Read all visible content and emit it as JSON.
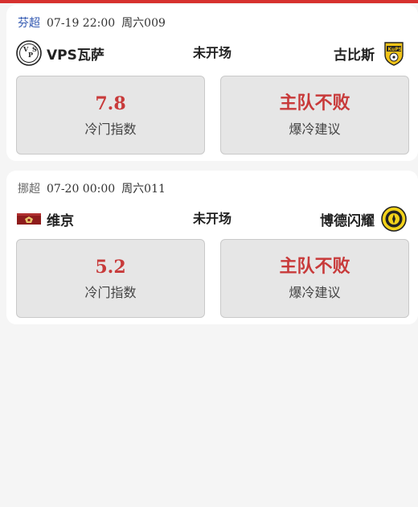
{
  "colors": {
    "accent": "#d6312f",
    "value_red": "#c83a3a",
    "league_blue": "#2f56b0"
  },
  "matches": [
    {
      "league": "芬超",
      "date": "07-19 22:00",
      "code": "周六009",
      "home": {
        "name": "VPS瓦萨",
        "logo_icon": "vps-crest-icon"
      },
      "status": "未开场",
      "away": {
        "name": "古比斯",
        "logo_icon": "kups-crest-icon"
      },
      "index_value": "7.8",
      "index_label": "冷门指数",
      "suggestion": "主队不败",
      "suggestion_label": "爆冷建议"
    },
    {
      "league": "挪超",
      "date": "07-20 00:00",
      "code": "周六011",
      "home": {
        "name": "维京",
        "logo_icon": "viking-crest-icon"
      },
      "status": "未开场",
      "away": {
        "name": "博德闪耀",
        "logo_icon": "bodo-glimt-crest-icon"
      },
      "index_value": "5.2",
      "index_label": "冷门指数",
      "suggestion": "主队不败",
      "suggestion_label": "爆冷建议"
    }
  ]
}
